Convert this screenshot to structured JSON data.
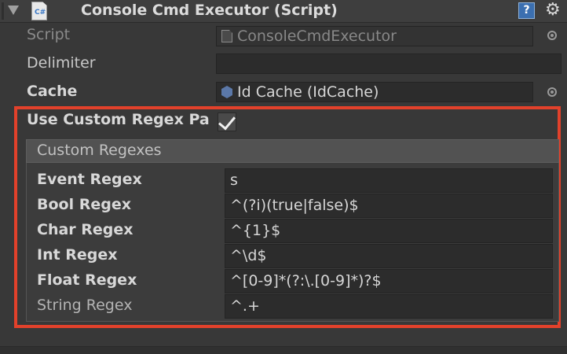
{
  "header": {
    "title": "Console Cmd Executor (Script)",
    "script_icon_label": "C#",
    "help_icon": "help-icon",
    "help_glyph": "?",
    "settings_icon": "gear-icon",
    "settings_glyph": "⚙"
  },
  "properties": {
    "script": {
      "label": "Script",
      "value": "ConsoleCmdExecutor"
    },
    "delimiter": {
      "label": "Delimiter",
      "value": ""
    },
    "cache": {
      "label": "Cache",
      "value": "Id Cache (IdCache)"
    },
    "use_custom_regex": {
      "label": "Use Custom Regex Pa",
      "checked": true
    }
  },
  "custom_regexes": {
    "title": "Custom Regexes",
    "rows": [
      {
        "label": "Event Regex",
        "value": "s"
      },
      {
        "label": "Bool Regex",
        "value": "^(?i)(true|false)$"
      },
      {
        "label": "Char Regex",
        "value": "^{1}$"
      },
      {
        "label": "Int Regex",
        "value": "^\\d$"
      },
      {
        "label": "Float Regex",
        "value": "^[0-9]*(?:\\.[0-9]*)?$"
      },
      {
        "label": "String Regex",
        "value": "^.+"
      }
    ]
  },
  "colors": {
    "background": "#383838",
    "highlight_border": "#e2412b",
    "field_background": "#2c2c2c"
  }
}
